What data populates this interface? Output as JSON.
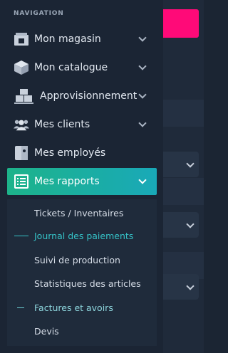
{
  "navigation": {
    "section_title": "NAVIGATION",
    "items": [
      {
        "label": "Mon magasin",
        "icon": "store-icon",
        "has_chevron": true
      },
      {
        "label": "Mon catalogue",
        "icon": "box-icon",
        "has_chevron": true
      },
      {
        "label": "Approvisionnement",
        "icon": "pallet-boxes-icon",
        "has_chevron": true
      },
      {
        "label": "Mes clients",
        "icon": "users-icon",
        "has_chevron": true
      },
      {
        "label": "Mes employés",
        "icon": "id-card-icon",
        "has_chevron": false
      },
      {
        "label": "Mes rapports",
        "icon": "report-list-icon",
        "has_chevron": true,
        "active": true
      }
    ],
    "submenu": [
      {
        "label": "Tickets / Inventaires"
      },
      {
        "label": "Journal des paiements",
        "current": true
      },
      {
        "label": "Suivi de production"
      },
      {
        "label": "Statistiques des articles"
      },
      {
        "label": "Factures et avoirs",
        "highlighted": true
      },
      {
        "label": "Devis"
      }
    ]
  },
  "colors": {
    "sidebar_bg": "#1b2534",
    "active_gradient_start": "#1db38a",
    "active_gradient_end": "#19a9b8",
    "accent_pink": "#ff0a78",
    "current_text": "#35c2c7"
  }
}
